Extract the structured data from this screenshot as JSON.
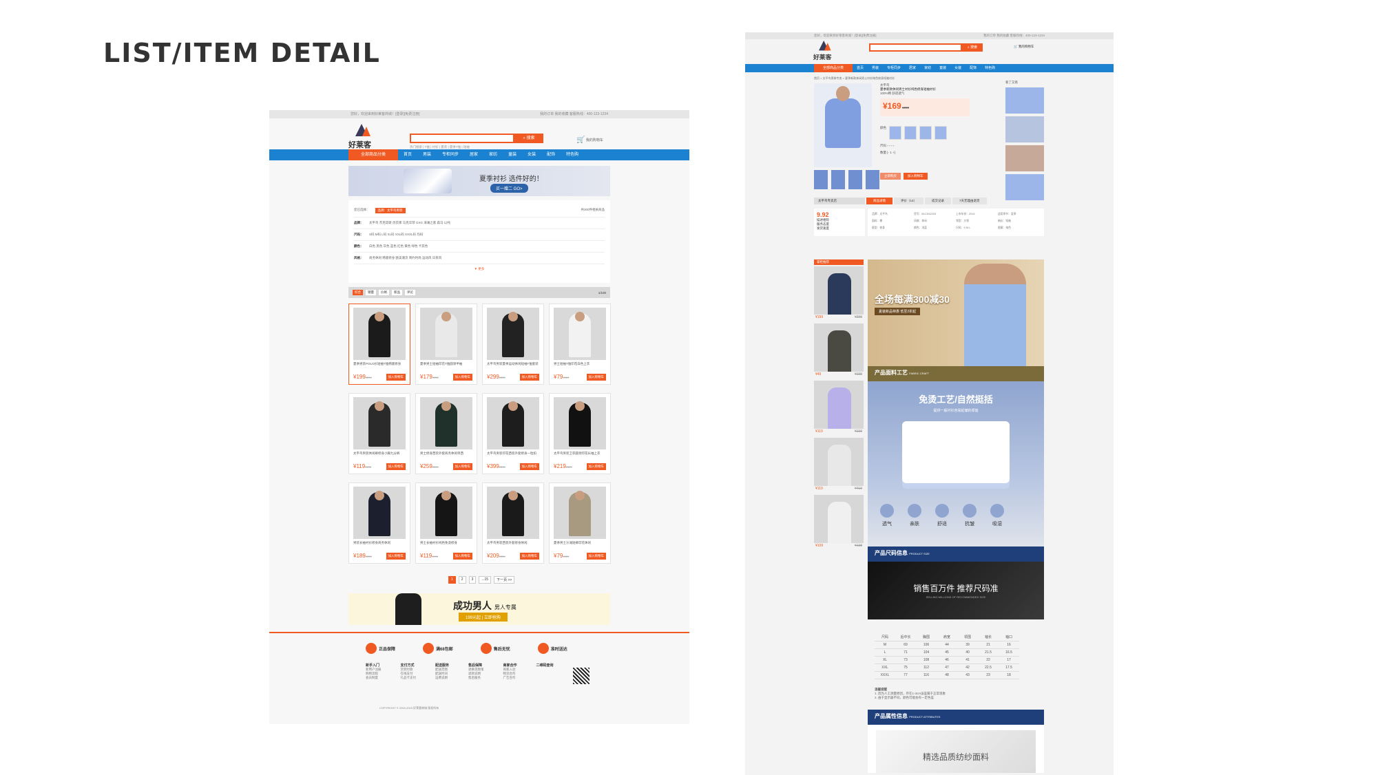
{
  "heading": "LIST/ITEM DETAIL",
  "colors": {
    "accent": "#f05a22",
    "nav": "#1a82d0"
  },
  "list": {
    "topbar_left": "您好，欢迎来到好莱客商城！[登录][免费注册]",
    "topbar_right": "我的订单  我的收藏  客服热线：400-123-1234",
    "logo": "好莱客",
    "search_btn": "搜索",
    "hot": "热门搜索 | T恤 | 衬衫 | 夏装 | 夏季T恤 | 短袖",
    "cart": "我的购物车",
    "nav": {
      "category": "全部商品分类",
      "items": [
        "首页",
        "男装",
        "专柜同步",
        "居家",
        "家纺",
        "童装",
        "女装",
        "配饰",
        "特色购"
      ]
    },
    "banner1": {
      "title": "夏季衬衫 选件好的！",
      "btn": "买一赠二  GO>"
    },
    "filter": {
      "selected_label": "您已选择：",
      "selected_chip": "品牌：太平鸟男装",
      "count": "共300件相关商品",
      "rows": [
        {
          "k": "品牌：",
          "v": "太平鸟  杰克琼斯  优衣库  马克华菲  GXG  海澜之家  森马  以纯"
        },
        {
          "k": "尺码：",
          "v": "S码  M码  L码  XL码  XXL码  XXXL码  均码"
        },
        {
          "k": "颜色：",
          "v": "白色  黑色  灰色  蓝色  红色  黄色  绿色  卡其色"
        },
        {
          "k": "风格：",
          "v": "商务休闲  韩版修身  欧美潮流  简约时尚  运动风  日系风"
        }
      ],
      "more": "更多"
    },
    "sort": {
      "items": [
        "综合",
        "销量",
        "价格",
        "新品",
        "评论"
      ],
      "pages": "1/100"
    },
    "products": [
      {
        "name": "夏季男装POLO衫短袖T恤韩版修身",
        "price": "¥199",
        "old": "¥299",
        "add": "加入购物车"
      },
      {
        "name": "夏季男士短袖印花T恤圆领半袖",
        "price": "¥179",
        "old": "¥259",
        "add": "加入购物车"
      },
      {
        "name": "太平鸟男装夏季运动休闲短袖T恤套装",
        "price": "¥299",
        "old": "¥399",
        "add": "加入购物车"
      },
      {
        "name": "男士短袖T恤印花白色上衣",
        "price": "¥79",
        "old": "¥129",
        "add": "加入购物车"
      },
      {
        "name": "太平鸟男装休闲裤修身小脚九分裤",
        "price": "¥119",
        "old": "¥199",
        "add": "加入购物车"
      },
      {
        "name": "男士修身西装外套商务休闲单西",
        "price": "¥259",
        "old": "¥399",
        "add": "加入购物车"
      },
      {
        "name": "太平鸟男装印花西装外套修身一粒扣",
        "price": "¥399",
        "old": "¥599",
        "add": "加入购物车"
      },
      {
        "name": "太平鸟男装卫衣圆领印花长袖上衣",
        "price": "¥219",
        "old": "¥329",
        "add": "加入购物车"
      },
      {
        "name": "男装长袖衬衫修身商务休闲",
        "price": "¥189",
        "old": "¥259",
        "add": "加入购物车"
      },
      {
        "name": "男士长袖衬衫纯色免烫修身",
        "price": "¥119",
        "old": "¥199",
        "add": "加入购物车"
      },
      {
        "name": "太平鸟男装西装外套修身休闲",
        "price": "¥209",
        "old": "¥359",
        "add": "加入购物车"
      },
      {
        "name": "夏季男士沙滩短裤印花休闲",
        "price": "¥79",
        "old": "¥129",
        "add": "加入购物车"
      }
    ],
    "pager": [
      "1",
      "2",
      "3",
      "...15",
      "下一页 >>"
    ],
    "banner2": {
      "title": "成功男人",
      "sub": "男人专属",
      "btn": "199元起 | 立即抢购"
    },
    "footer": {
      "guarantees": [
        "正品保障",
        "满68包邮",
        "售后无忧",
        "准时送达"
      ],
      "cols": [
        {
          "h": "新手入门",
          "items": [
            "新用户注册",
            "购物流程",
            "会员制度"
          ]
        },
        {
          "h": "支付方式",
          "items": [
            "货到付款",
            "在线支付",
            "礼品卡支付"
          ]
        },
        {
          "h": "配送服务",
          "items": [
            "配送范围",
            "配送时间",
            "运费说明"
          ]
        },
        {
          "h": "售后保障",
          "items": [
            "退换货政策",
            "退款说明",
            "售后服务"
          ]
        },
        {
          "h": "商家合作",
          "items": [
            "商家入驻",
            "物流合作",
            "广告合作"
          ]
        },
        {
          "h": "二维码查询",
          "items": []
        }
      ],
      "copyright": "COPYRIGHT © 2004-2015 好莱客商城 版权所有"
    }
  },
  "detail": {
    "topbar_left": "您好，欢迎来到好莱客商城！[登录][免费注册]",
    "topbar_right": "我的订单  我的收藏  客服热线：400-123-1234",
    "search_btn": "搜索",
    "cart": "我的购物车",
    "nav": {
      "category": "全部商品分类",
      "items": [
        "首页",
        "男装",
        "专柜同步",
        "居家",
        "家纺",
        "童装",
        "女装",
        "配饰",
        "特色购"
      ]
    },
    "crumb": "首页 > 太平鸟男装专卖 > 夏季新款休闲男士衬衫纯色修身短袖衬衫",
    "product": {
      "brand": "太平鸟",
      "title": "夏季新款休闲男士衬衫纯色修身短袖衬衫",
      "tag": "100%棉  舒适透气",
      "price": "¥169",
      "old": "¥299",
      "labels": {
        "color": "颜色",
        "size": "尺码",
        "qty": "数量"
      },
      "buy": "立即购买",
      "add": "加入购物车"
    },
    "side_title": "看了又看",
    "side_prices": [
      "¥199",
      "¥169",
      "¥199",
      "¥219"
    ],
    "tabs": {
      "shop": "太平鸟专卖店",
      "items": [
        "商品详情",
        "评价（14）",
        "成交记录",
        "7天无理由退货"
      ]
    },
    "shop": {
      "score": "9.92",
      "a": "描述相符",
      "b": "服务态度",
      "c": "发货速度"
    },
    "attrs": [
      "品牌：太平鸟",
      "货号：B1CD52203",
      "上市年份：2015",
      "适用季节：夏季",
      "面料：棉",
      "风格：休闲",
      "领型：方领",
      "袖长：短袖",
      "版型：修身",
      "颜色：浅蓝",
      "尺码：S M L",
      "图案：纯色"
    ],
    "reco": {
      "title": "掌柜推荐",
      "items": [
        {
          "p": "¥199",
          "o": "¥299"
        },
        {
          "p": "¥49",
          "o": "¥199"
        },
        {
          "p": "¥119",
          "o": "¥199"
        },
        {
          "p": "¥119",
          "o": "¥419"
        },
        {
          "p": "¥109",
          "o": "¥138"
        }
      ]
    },
    "banner_top": {
      "title": "全场每满300减30",
      "sub": "夏装新品特惠  低至2折起"
    },
    "sec1": {
      "t": "产品面料工艺",
      "e": "FABRIC CRAFT"
    },
    "fabric": {
      "title": "免烫工艺/自然挺括",
      "sub": "提供一般衬衫容易起皱的烦恼",
      "icons": [
        "透气",
        "亲肤",
        "舒适",
        "抗皱",
        "吸湿"
      ]
    },
    "sec2": {
      "t": "产品尺码信息",
      "e": "PRODUCT SIZE"
    },
    "dark": {
      "title": "销售百万件 推荐尺码准",
      "sub": "SELLING MILLIONS OF RECOMMENDED SIZE"
    },
    "size_table": {
      "header": [
        "尺码",
        "后中长",
        "胸围",
        "肩宽",
        "领围",
        "袖长",
        "袖口"
      ],
      "rows": [
        [
          "M",
          "69",
          "106",
          "44",
          "39",
          "21",
          "16"
        ],
        [
          "L",
          "71",
          "104",
          "45",
          "40",
          "21.5",
          "16.5"
        ],
        [
          "XL",
          "73",
          "108",
          "46",
          "41",
          "22",
          "17"
        ],
        [
          "XXL",
          "75",
          "112",
          "47",
          "42",
          "22.5",
          "17.5"
        ],
        [
          "XXXL",
          "77",
          "116",
          "48",
          "43",
          "23",
          "18"
        ]
      ]
    },
    "notes": {
      "h": "温馨提醒",
      "l1": "1. 因为人工测量原因，存在1-3cm误差属于正常现象",
      "l2": "2. 由于显示器不同，颜色可能会有一定色差"
    },
    "sec3": {
      "t": "产品属性信息",
      "e": "PRODUCT ATTRIBUTES"
    },
    "attr_img": "精选品质纺纱面料"
  }
}
